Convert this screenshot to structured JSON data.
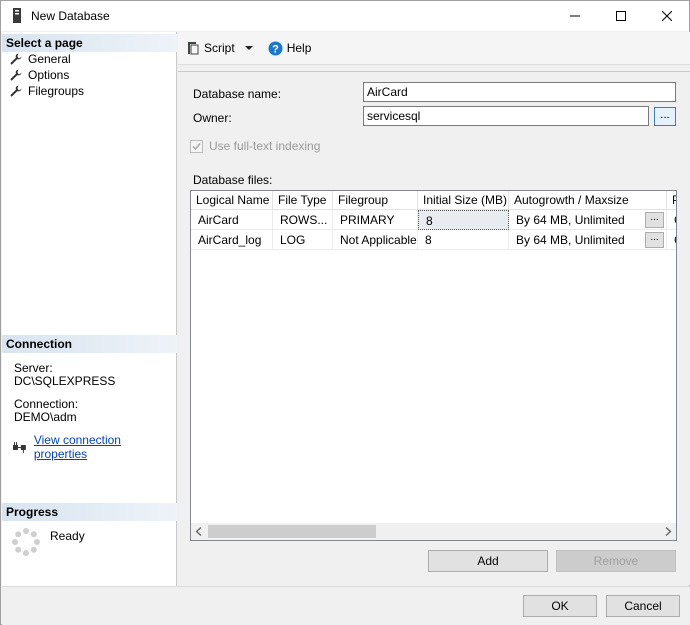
{
  "window": {
    "title": "New Database"
  },
  "left": {
    "select_page_header": "Select a page",
    "pages": [
      {
        "label": "General",
        "icon": "wrench-icon"
      },
      {
        "label": "Options",
        "icon": "wrench-icon"
      },
      {
        "label": "Filegroups",
        "icon": "wrench-icon"
      }
    ],
    "connection_header": "Connection",
    "server_label": "Server:",
    "server_value": "DC\\SQLEXPRESS",
    "connection_label": "Connection:",
    "connection_value": "DEMO\\adm",
    "view_connection_link": "View connection properties",
    "progress_header": "Progress",
    "progress_status": "Ready"
  },
  "toolbar": {
    "script_label": "Script",
    "help_label": "Help"
  },
  "form": {
    "database_name_label": "Database name:",
    "database_name_value": "AirCard",
    "owner_label": "Owner:",
    "owner_value": "servicesql",
    "browse_label": "...",
    "fulltext_label": "Use full-text indexing",
    "files_label": "Database files:"
  },
  "grid": {
    "columns": [
      "Logical Name",
      "File Type",
      "Filegroup",
      "Initial Size (MB)",
      "Autogrowth / Maxsize",
      "P"
    ],
    "rows": [
      {
        "logical_name": "AirCard",
        "file_type": "ROWS...",
        "filegroup": "PRIMARY",
        "initial_size": "8",
        "autogrowth": "By 64 MB, Unlimited",
        "btn": "...",
        "extra": "C"
      },
      {
        "logical_name": "AirCard_log",
        "file_type": "LOG",
        "filegroup": "Not Applicable",
        "initial_size": "8",
        "autogrowth": "By 64 MB, Unlimited",
        "btn": "...",
        "extra": "C"
      }
    ]
  },
  "buttons": {
    "add": "Add",
    "remove": "Remove",
    "ok": "OK",
    "cancel": "Cancel"
  },
  "colors": {
    "link": "#0645ad",
    "header_gradient": "#d8e4f0",
    "help_icon": "#1e78c8"
  }
}
